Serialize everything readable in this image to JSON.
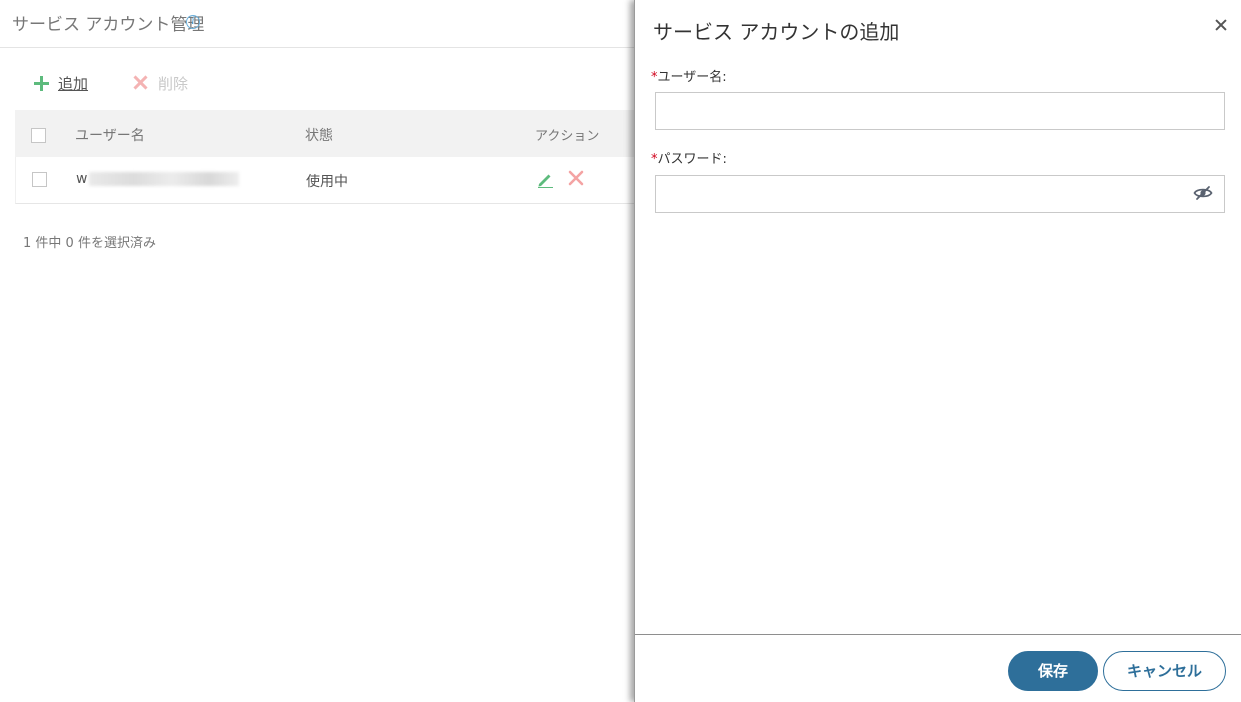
{
  "page": {
    "title": "サービス アカウント管理",
    "info_icon": "ⓘ",
    "toolbar": {
      "add_label": "追加",
      "delete_label": "削除"
    },
    "table": {
      "columns": [
        "ユーザー名",
        "状態",
        "アクション"
      ],
      "rows": [
        {
          "username_prefix": "w",
          "status": "使用中"
        }
      ]
    },
    "selection_text": "1 件中 0 件を選択済み"
  },
  "drawer": {
    "title": "サービス アカウントの追加",
    "required_mark": "*",
    "username_label": "ユーザー名:",
    "username_value": "",
    "password_label": "パスワード:",
    "password_value": "",
    "save_label": "保存",
    "cancel_label": "キャンセル"
  },
  "colors": {
    "primary": "#2e6f9a",
    "add_green": "#5dbb7d",
    "delete_red": "#f4b3b3",
    "required_red": "#d0021b"
  }
}
